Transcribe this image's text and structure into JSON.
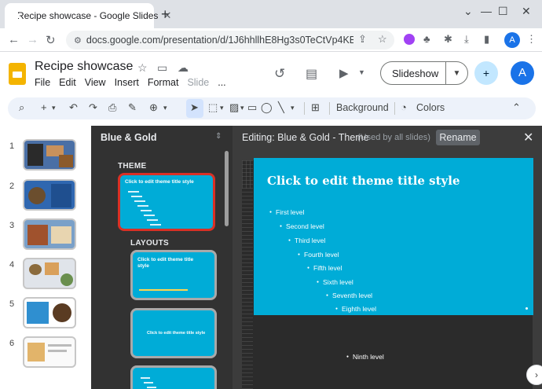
{
  "browser": {
    "tab_title": "Recipe showcase - Google Slides",
    "url": "docs.google.com/presentation/d/1J6hhllhE8Hg3s0TeCtVp4KB0KL...",
    "profile_initial": "A"
  },
  "app": {
    "doc_title": "Recipe showcase",
    "menu": [
      "File",
      "Edit",
      "View",
      "Insert",
      "Format",
      "Slide",
      "..."
    ],
    "slideshow_label": "Slideshow",
    "profile_initial": "A"
  },
  "toolbar": {
    "background_label": "Background",
    "colors_label": "Colors"
  },
  "filmstrip": {
    "numbers": [
      "1",
      "2",
      "3",
      "4",
      "5",
      "6"
    ]
  },
  "theme_panel": {
    "theme_name": "Blue & Gold",
    "theme_section": "THEME",
    "layouts_section": "LAYOUTS",
    "theme_thumb_title": "Click to edit theme title style",
    "layout1_title": "Click to edit theme title style",
    "layout2_title": "Click to edit theme title style"
  },
  "editor": {
    "editing_label": "Editing: Blue & Gold - Theme",
    "used_label": "(Used by all slides)",
    "rename_label": "Rename",
    "slide_title": "Click to edit theme title style",
    "levels": [
      "First level",
      "Second level",
      "Third level",
      "Fourth level",
      "Fifth level",
      "Sixth level",
      "Seventh level",
      "Eighth level",
      "Ninth level"
    ]
  },
  "colors": {
    "theme_blue": "#00acd7",
    "editor_bg": "#3c3c3c",
    "selection_red": "#d93025",
    "slides_yellow": "#f4b400"
  }
}
